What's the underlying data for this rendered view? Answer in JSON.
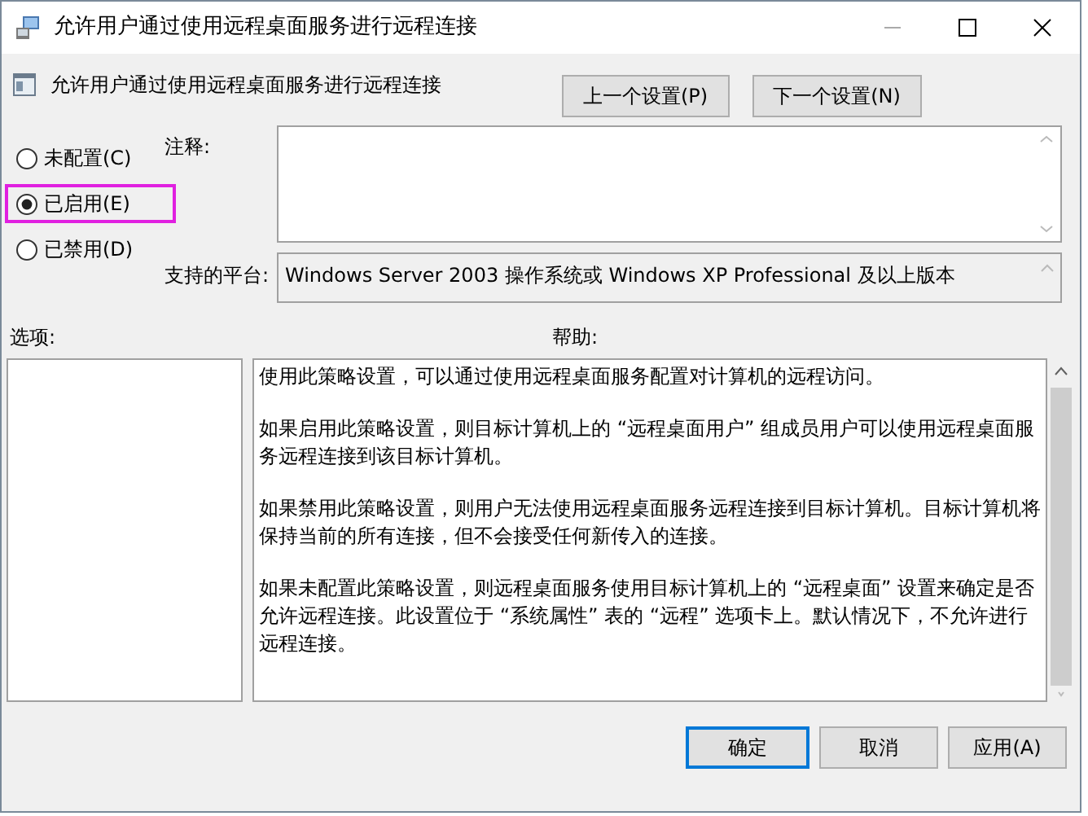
{
  "window": {
    "title": "允许用户通过使用远程桌面服务进行远程连接"
  },
  "policy": {
    "title": "允许用户通过使用远程桌面服务进行远程连接"
  },
  "nav_buttons": [
    "上一个设置(P)",
    "下一个设置(N)"
  ],
  "options": [
    {
      "label": "未配置(C)",
      "selected": false
    },
    {
      "label": "已启用(E)",
      "selected": true
    },
    {
      "label": "已禁用(D)",
      "selected": false
    }
  ],
  "comment": {
    "label": "注释:"
  },
  "platform": {
    "label": "支持的平台:",
    "value": "Windows Server 2003 操作系统或 Windows XP Professional 及以上版本"
  },
  "options_panel": {
    "label": "选项:"
  },
  "help": {
    "label": "帮助:",
    "paragraphs": [
      "使用此策略设置，可以通过使用远程桌面服务配置对计算机的远程访问。",
      "如果启用此策略设置，则目标计算机上的 “远程桌面用户” 组成员用户可以使用远程桌面服务远程连接到该目标计算机。",
      "如果禁用此策略设置，则用户无法使用远程桌面服务远程连接到目标计算机。目标计算机将保持当前的所有连接，但不会接受任何新传入的连接。",
      "如果未配置此策略设置，则远程桌面服务使用目标计算机上的 “远程桌面” 设置来确定是否允许远程连接。此设置位于 “系统属性” 表的 “远程” 选项卡上。默认情况下，不允许进行远程连接。"
    ]
  },
  "buttons": [
    {
      "label": "确定",
      "default": true
    },
    {
      "label": "取消",
      "default": false
    },
    {
      "label": "应用(A)",
      "default": false
    }
  ]
}
